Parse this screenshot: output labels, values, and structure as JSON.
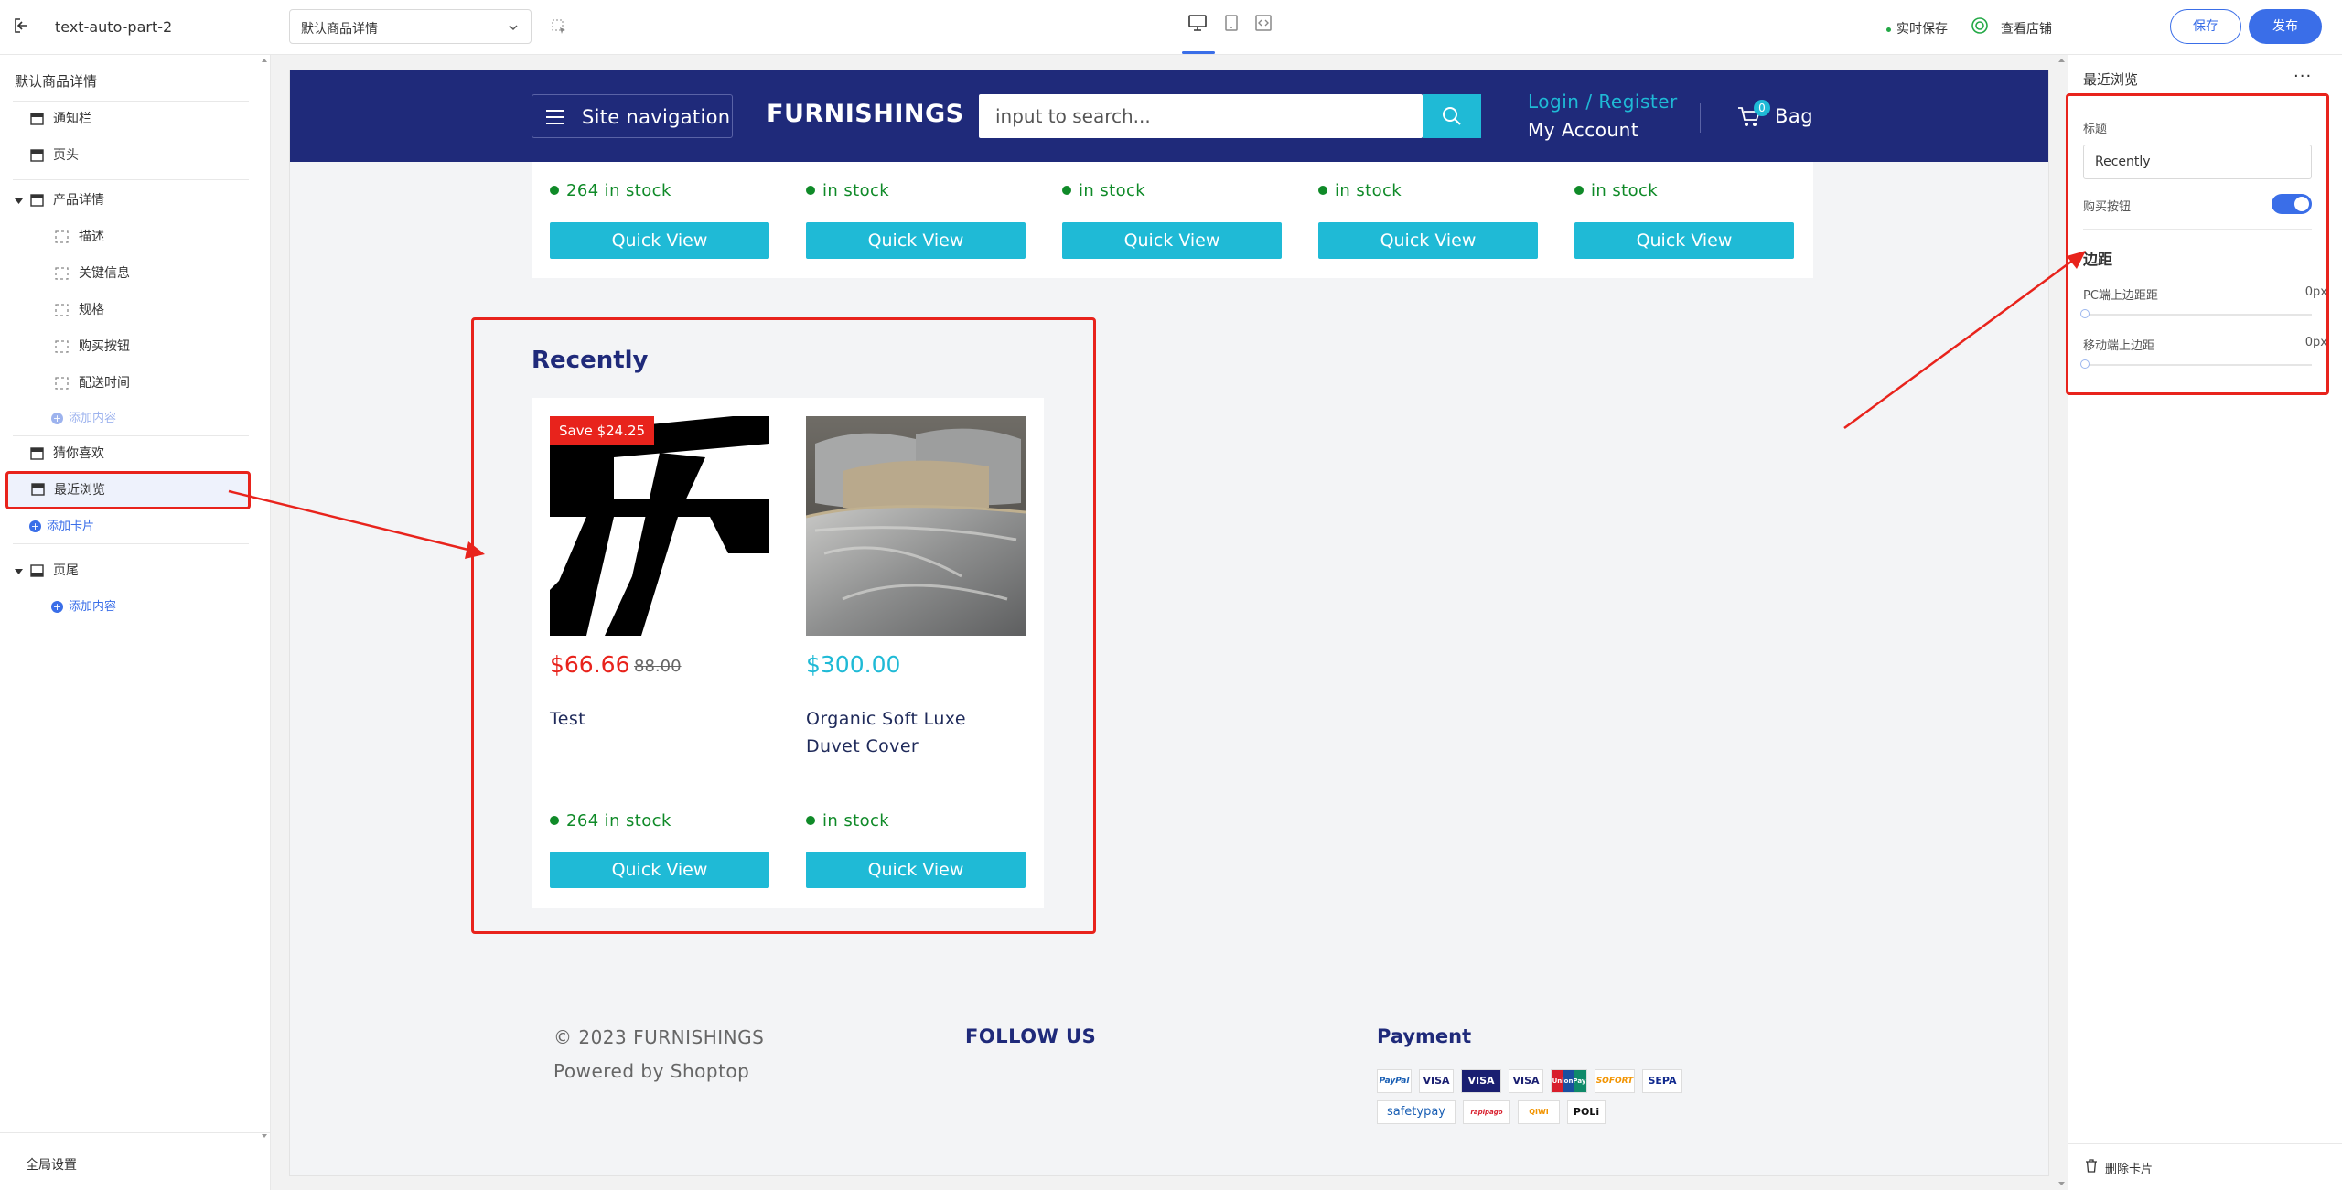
{
  "topbar": {
    "project_name": "text-auto-part-2",
    "template_select": "默认商品详情",
    "realtime_save": "实时保存",
    "view_store": "查看店铺",
    "save": "保存",
    "publish": "发布"
  },
  "sidebar": {
    "title": "默认商品详情",
    "items": {
      "notice": "通知栏",
      "header": "页头",
      "product_detail": "产品详情",
      "desc": "描述",
      "key_info": "关键信息",
      "spec": "规格",
      "buy_button": "购买按钮",
      "delivery": "配送时间",
      "add_content_1": "添加内容",
      "guess_like": "猜你喜欢",
      "recent": "最近浏览",
      "add_card": "添加卡片",
      "footer": "页尾",
      "add_content_2": "添加内容"
    },
    "global_settings": "全局设置"
  },
  "site": {
    "nav_label": "Site navigation",
    "brand": "FURNISHINGS",
    "search_placeholder": "input to search...",
    "login": "Login / Register",
    "account": "My Account",
    "bag_count": "0",
    "bag": "Bag"
  },
  "top_strip": {
    "stock": [
      "264 in stock",
      "in stock",
      "in stock",
      "in stock",
      "in stock"
    ],
    "quick_view": "Quick View"
  },
  "recently": {
    "title": "Recently",
    "products": [
      {
        "badge": "Save $24.25",
        "price": "$66.66",
        "old_price": "88.00",
        "name": "Test",
        "stock": "264 in stock",
        "quick_view": "Quick View"
      },
      {
        "price": "$300.00",
        "name": "Organic Soft Luxe Duvet Cover",
        "stock": "in stock",
        "quick_view": "Quick View"
      }
    ]
  },
  "footer": {
    "copyright": "© 2023 FURNISHINGS",
    "powered": "Powered by Shoptop",
    "follow": "FOLLOW US",
    "payment": "Payment",
    "cards": [
      "PayPal",
      "VISA",
      "VISA",
      "VISA",
      "UnionPay",
      "SOFORT",
      "SEPA",
      "safetypay",
      "rapipago",
      "QIWI",
      "POLi"
    ]
  },
  "panel": {
    "title": "最近浏览",
    "more": "···",
    "title_label": "标题",
    "title_value": "Recently",
    "buy_button_label": "购买按钮",
    "buy_button_on": true,
    "spacing_section": "边距",
    "pc_top_label": "PC端上边距距",
    "pc_top_value": "0px",
    "mobile_top_label": "移动端上边距",
    "mobile_top_value": "0px",
    "delete_card": "删除卡片"
  },
  "colors": {
    "accent": "#3a6ee8",
    "navy": "#1f2a7a",
    "cyan": "#1fbad6",
    "red": "#e8231c",
    "green": "#0f8a28"
  }
}
